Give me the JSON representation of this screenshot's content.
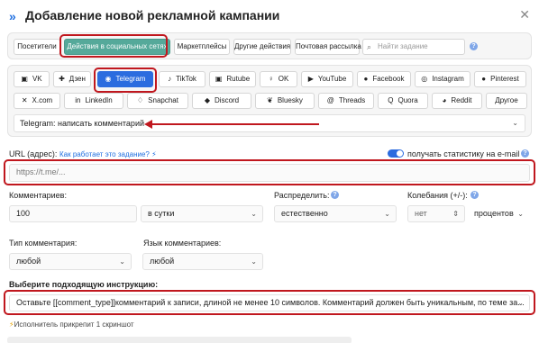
{
  "header": {
    "logo_glyph": "»",
    "title": "Добавление новой рекламной кампании",
    "close_glyph": "✕"
  },
  "tabs": [
    {
      "label": "Посетители",
      "active": false
    },
    {
      "label": "Действия в социальных сетях",
      "active": true
    },
    {
      "label": "Маркетплейсы",
      "active": false
    },
    {
      "label": "Другие действия",
      "active": false
    },
    {
      "label": "Почтовая рассылка",
      "active": false
    }
  ],
  "search": {
    "placeholder": "Найти задание",
    "icon": "search-icon"
  },
  "help_glyph": "?",
  "networks": [
    {
      "label": "VK",
      "icon": "vk-icon",
      "glyph": "▣"
    },
    {
      "label": "Дзен",
      "icon": "dzen-icon",
      "glyph": "✚"
    },
    {
      "label": "Telegram",
      "icon": "telegram-icon",
      "glyph": "◉",
      "active": true
    },
    {
      "label": "TikTok",
      "icon": "tiktok-icon",
      "glyph": "♪"
    },
    {
      "label": "Rutube",
      "icon": "rutube-icon",
      "glyph": "▣"
    },
    {
      "label": "OK",
      "icon": "ok-icon",
      "glyph": "♀"
    },
    {
      "label": "YouTube",
      "icon": "youtube-icon",
      "glyph": "▶"
    },
    {
      "label": "Facebook",
      "icon": "facebook-icon",
      "glyph": "●"
    },
    {
      "label": "Instagram",
      "icon": "instagram-icon",
      "glyph": "◎"
    },
    {
      "label": "Pinterest",
      "icon": "pinterest-icon",
      "glyph": "●"
    },
    {
      "label": "X.com",
      "icon": "x-icon",
      "glyph": "✕"
    },
    {
      "label": "LinkedIn",
      "icon": "linkedin-icon",
      "glyph": "in"
    },
    {
      "label": "Snapchat",
      "icon": "snapchat-icon",
      "glyph": "♢"
    },
    {
      "label": "Discord",
      "icon": "discord-icon",
      "glyph": "◆"
    },
    {
      "label": "Bluesky",
      "icon": "bluesky-icon",
      "glyph": "❦"
    },
    {
      "label": "Threads",
      "icon": "threads-icon",
      "glyph": "@"
    },
    {
      "label": "Quora",
      "icon": "quora-icon",
      "glyph": "Q"
    },
    {
      "label": "Reddit",
      "icon": "reddit-icon",
      "glyph": "◕"
    },
    {
      "label": "Другое",
      "icon": "",
      "glyph": ""
    }
  ],
  "task_select": {
    "value": "Telegram: написать комментарий",
    "chevron": "⌄"
  },
  "url": {
    "label": "URL (адрес):",
    "help_link": "Как работает это задание?",
    "bolt": "⚡",
    "placeholder": "https://t.me/...",
    "stats_label": "получать статистику на e-mail",
    "stats_enabled": true
  },
  "comments": {
    "label": "Комментариев:",
    "value": "100",
    "period": "в сутки"
  },
  "distribute": {
    "label": "Распределить:",
    "value": "естественно"
  },
  "fluctuation": {
    "label": "Колебания (+/-):",
    "value": "нет",
    "unit": "процентов"
  },
  "comment_type": {
    "label": "Тип комментария:",
    "value": "любой"
  },
  "comment_lang": {
    "label": "Язык комментариев:",
    "value": "любой"
  },
  "instruction": {
    "label": "Выберите подходящую инструкцию:",
    "value": "Оставьте [[comment_type]]комментарий к записи, длиной не менее 10 символов. Комментарий должен быть уникальным, по теме за..."
  },
  "screenshot_note": "Исполнитель прикрепит 1 скриншот",
  "colors": {
    "accent": "#2b6cdf",
    "tab_active": "#55a99a",
    "highlight": "#c0171e"
  }
}
